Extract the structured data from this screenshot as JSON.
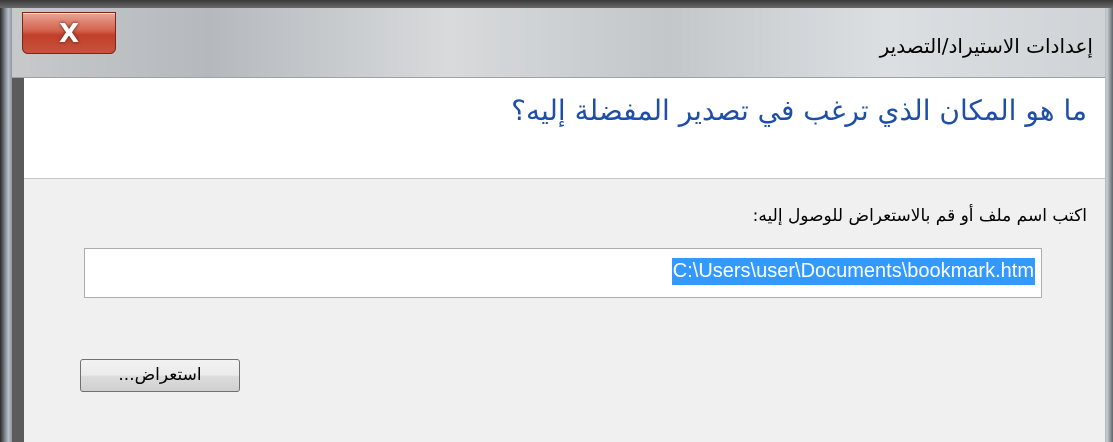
{
  "window": {
    "title": "إعدادات الاستيراد/التصدير",
    "close_label": "X"
  },
  "header": {
    "heading": "ما هو المكان الذي ترغب في تصدير المفضلة إليه؟"
  },
  "form": {
    "prompt": "اكتب اسم ملف أو قم بالاستعراض للوصول إليه:",
    "path_value": "C:\\Users\\user\\Documents\\bookmark.htm",
    "browse_label": "استعراض..."
  },
  "colors": {
    "heading": "#1e4fa8",
    "selection": "#3399ff",
    "close_button": "#c13f2a"
  }
}
